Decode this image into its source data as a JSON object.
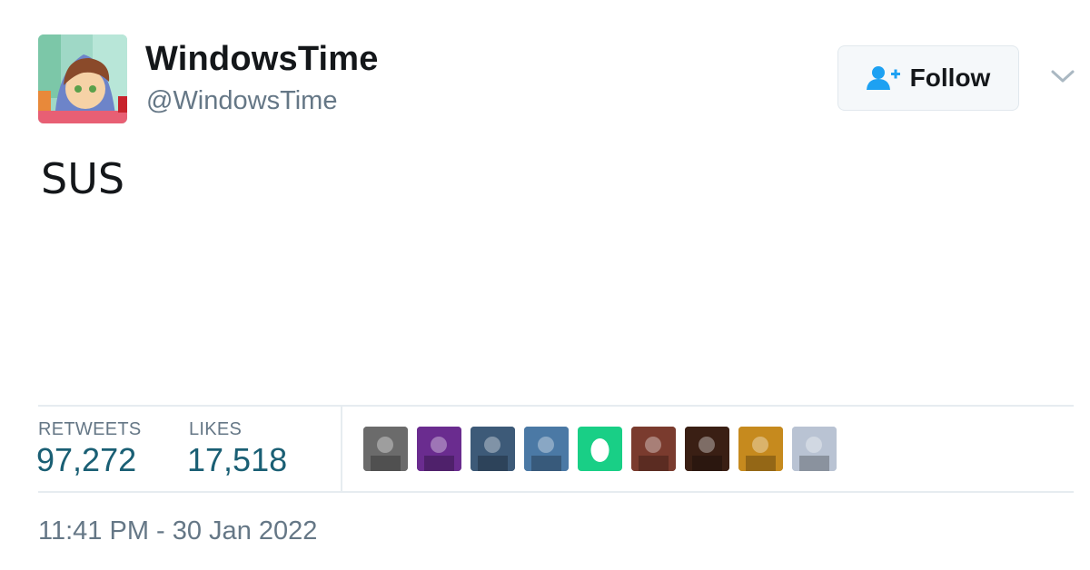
{
  "author": {
    "display_name": "WindowsTime",
    "handle": "@WindowsTime",
    "avatar_icon": "cartoon-boy-avatar"
  },
  "follow_button": {
    "label": "Follow",
    "icon": "add-user-icon"
  },
  "menu": {
    "icon": "chevron-down-icon"
  },
  "tweet": {
    "text": "SUS"
  },
  "stats": {
    "retweets_label": "RETWEETS",
    "retweets_value": "97,272",
    "likes_label": "LIKES",
    "likes_value": "17,518"
  },
  "likers": [
    {
      "name": "liker-avatar-bw-group",
      "color": "#6b6b6b"
    },
    {
      "name": "liker-avatar-purple-rose",
      "color": "#6a2c8f"
    },
    {
      "name": "liker-avatar-blue-scene",
      "color": "#3d5a78"
    },
    {
      "name": "liker-avatar-van",
      "color": "#4b79a5"
    },
    {
      "name": "liker-avatar-default-egg",
      "color": "#19cf86"
    },
    {
      "name": "liker-avatar-crowd",
      "color": "#7a3b2e"
    },
    {
      "name": "liker-avatar-dark-portrait",
      "color": "#3a1f14"
    },
    {
      "name": "liker-avatar-sunset-figure",
      "color": "#c68a1e"
    },
    {
      "name": "liker-avatar-man-portrait",
      "color": "#b9c3d3"
    }
  ],
  "timestamp": "11:41 PM - 30 Jan 2022",
  "colors": {
    "text_primary": "#14171a",
    "text_secondary": "#657786",
    "stat_value": "#1a5f74",
    "divider": "#e6ecf0",
    "follow_icon": "#1da1f2"
  }
}
